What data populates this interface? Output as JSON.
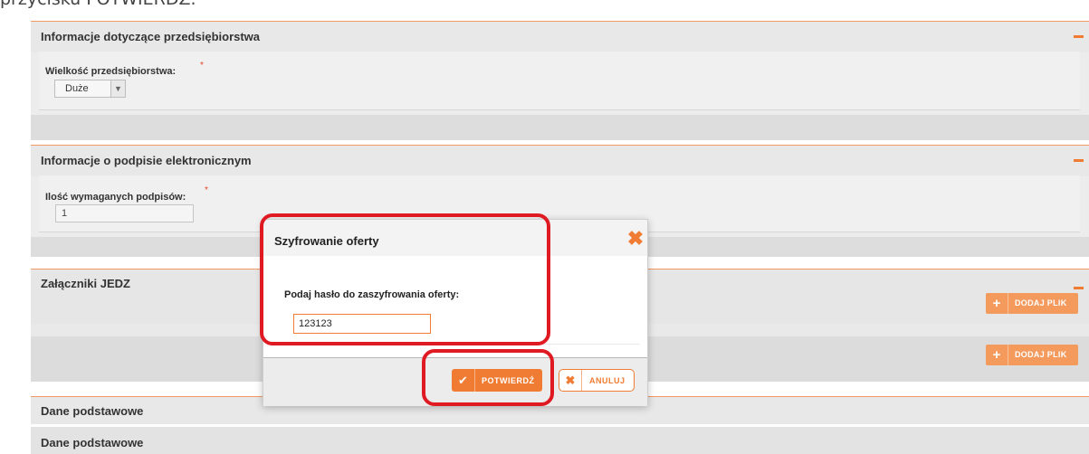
{
  "caption": "przycisku POTWIERDŹ.",
  "panels": {
    "enterprise": {
      "title": "Informacje dotyczące przedsiębiorstwa",
      "size_label": "Wielkość przedsiębiorstwa:",
      "size_value": "Duże"
    },
    "signature": {
      "title": "Informacje o podpisie elektronicznym",
      "count_label": "Ilość wymaganych podpisów:",
      "count_value": "1"
    },
    "jedz": {
      "title": "Załączniki JEDZ",
      "add_file_label": "DODAJ PLIK"
    },
    "basic": {
      "title1": "Dane podstawowe",
      "title2": "Dane podstawowe"
    }
  },
  "modal": {
    "title": "Szyfrowanie oferty",
    "password_label": "Podaj hasło do zaszyfrowania oferty:",
    "password_value": "123123",
    "confirm_label": "POTWIERDŹ",
    "cancel_label": "ANULUJ"
  },
  "colors": {
    "accent": "#f07c33",
    "highlight": "#e01a22"
  },
  "icons": {
    "collapse": "minus-icon",
    "close": "close-x-icon",
    "add": "plus-icon",
    "confirm": "checkmark-icon",
    "cancel": "x-icon",
    "dropdown": "chevron-down-icon"
  }
}
